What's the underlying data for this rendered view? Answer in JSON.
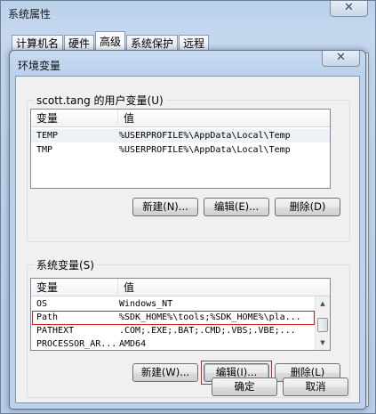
{
  "sys_window": {
    "title": "系统属性",
    "close_glyph": "✕",
    "tabs": [
      "计算机名",
      "硬件",
      "高级",
      "系统保护",
      "远程"
    ],
    "active_tab": "高级"
  },
  "env_dialog": {
    "title": "环境变量",
    "close_glyph": "✕",
    "user_group_label": "scott.tang 的用户变量(U)",
    "user_vars": {
      "col_name": "变量",
      "col_value": "值",
      "rows": [
        {
          "name": "TEMP",
          "value": "%USERPROFILE%\\AppData\\Local\\Temp"
        },
        {
          "name": "TMP",
          "value": "%USERPROFILE%\\AppData\\Local\\Temp"
        }
      ]
    },
    "user_buttons": {
      "new": "新建(N)...",
      "edit": "编辑(E)...",
      "delete": "删除(D)"
    },
    "sys_group_label": "系统变量(S)",
    "sys_vars": {
      "col_name": "变量",
      "col_value": "值",
      "rows": [
        {
          "name": "OS",
          "value": "Windows_NT"
        },
        {
          "name": "Path",
          "value": "%SDK_HOME%\\tools;%SDK_HOME%\\pla..."
        },
        {
          "name": "PATHEXT",
          "value": ".COM;.EXE;.BAT;.CMD;.VBS;.VBE;..."
        },
        {
          "name": "PROCESSOR_AR...",
          "value": "AMD64"
        }
      ],
      "highlighted_row": "Path"
    },
    "sys_buttons": {
      "new": "新建(W)...",
      "edit": "编辑(I)...",
      "delete": "删除(L)"
    },
    "ok_label": "确定",
    "cancel_label": "取消"
  },
  "colors": {
    "highlight_outline": "#d02020",
    "window_frame": "#bcd2ec",
    "dialog_client": "#f0f0f0"
  }
}
